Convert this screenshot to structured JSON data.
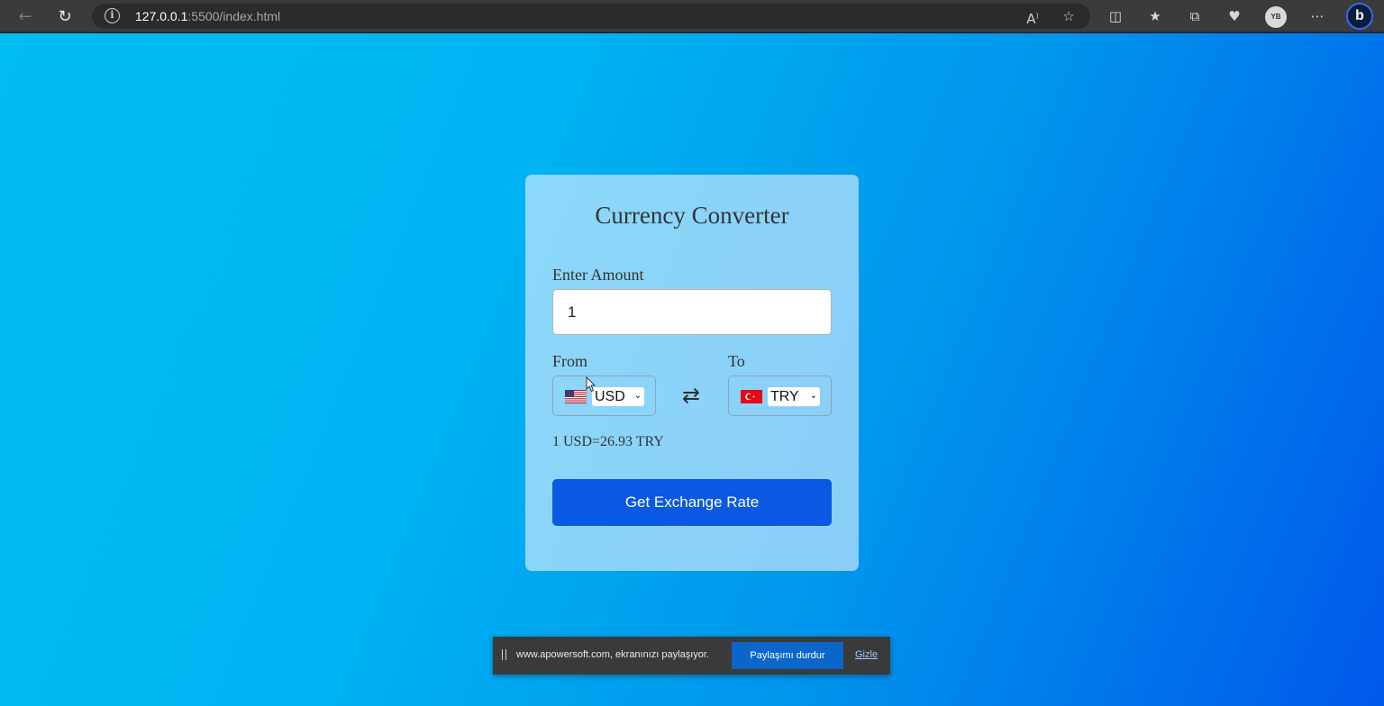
{
  "browser": {
    "url_host": "127.0.0.1",
    "url_rest": ":5500/index.html",
    "profile_initials": "YB"
  },
  "converter": {
    "title": "Currency Converter",
    "amount_label": "Enter Amount",
    "amount_value": "1",
    "from_label": "From",
    "to_label": "To",
    "from_currency": "USD",
    "to_currency": "TRY",
    "rate_text": "1 USD=26.93 TRY",
    "button_label": "Get Exchange Rate"
  },
  "share_bar": {
    "message": "www.apowersoft.com, ekranınızı paylaşıyor.",
    "stop_label": "Paylaşımı durdur",
    "hide_label": "Gizle"
  },
  "colors": {
    "button": "#0b58e3",
    "bg_start": "#00bdf2",
    "bg_end": "#0058ea"
  }
}
